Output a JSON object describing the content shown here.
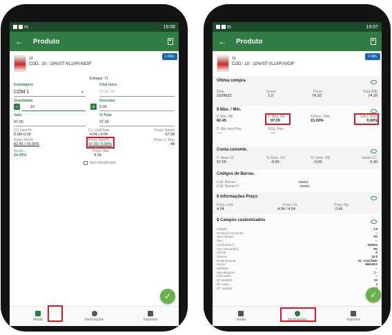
{
  "status": {
    "time_left": "19:06",
    "time_right": "19:07",
    "left_glyph": "m"
  },
  "appbar": {
    "title": "Produto",
    "info_button": "+ Info."
  },
  "product": {
    "code": "10",
    "description": "COD.: 10 - 10%/ST-VL1/IPI-N/DIF"
  },
  "venda": {
    "estoque": "Estoque: 71",
    "embalagem_label": "Embalagem",
    "embalagem_value": "COM 1",
    "filial_label": "Filial retira",
    "filial_value": "FILIAL 99",
    "quantidade_label": "Quantidade",
    "quantidade_value": "10",
    "desconto_label": "Desconto",
    "desconto_value": "0.00",
    "valor_label": "Valor",
    "valor_value": "97.00",
    "vl_total_label": "Vl Total",
    "vl_total_value": "97.00",
    "cc_label": "CC Valor/%",
    "cc_value": "0.00/-0.00",
    "ct_label": "C.t. Unit/Total",
    "ct_value": "4.04 / 4.04",
    "preco_sub_label": "Preço Tabela",
    "preco_sub_value": "97.00",
    "preco_min_label": "Preço Min/%",
    "preco_min_value": "82.45 / 15.00%",
    "preco_max_label": "Preço Máx/%",
    "preco_max_value": "97.00 / 0.00%",
    "preco_s_label": "Preço S. Mun",
    "preco_s_value": "48",
    "lucro_label": "%Lucr.:",
    "lucro_value": "24.95%",
    "preco_unit_label": "Preço Unit.",
    "preco_unit_value": "4.04",
    "bonificado_label": "Item Bonificado"
  },
  "info": {
    "ultima_compra": {
      "title": "Última compra",
      "data_label": "Data",
      "data": "15/08/22",
      "quant_label": "Quant.",
      "quant": "1.0",
      "preco_label": "Preço",
      "preco": "74.20",
      "total_label": "Total (R$)",
      "total": "74.20"
    },
    "maxmin": {
      "title": "$ Máx. / Mín.",
      "pmin_label": "P. Mín. R$",
      "pmin": "82.45",
      "pmax_label": "P. Máx. R$",
      "pmax": "97.00",
      "desc_label": "%Desc. Máx",
      "desc": "15.00%",
      "acr_label": "%Acr. Máx.",
      "acr": "0,00%",
      "pmin_flex_label": "P. Mín sem Flex.",
      "pmin_flex": "----",
      "flex_label": "%Sd. Flex.",
      "flex": "----"
    },
    "conta": {
      "title": "Conta corrente.",
      "base_label": "P. Base CC.",
      "base": "97.00",
      "pdesc_label": "% Desc. CC",
      "pdesc": "-0.00",
      "vdesc_label": "Vl. Desc. R$",
      "vdesc": "-0.00",
      "saldo_label": "Saldo CC.",
      "saldo": "0.00"
    },
    "barras": {
      "title": "Códigos de Barras.",
      "cod_label": "Cód. Barras:",
      "cod": "100001",
      "codb_label": "Cód. Barras D:",
      "codb": "100001"
    },
    "preco": {
      "title": "$ Informações Preço",
      "unit_label": "Preço Unit.",
      "unit": "4.04",
      "cx_label": "Preço Cx.",
      "cx": "4.04 / 4.04",
      "kg_label": "Preço Kg",
      "kg": "0.40"
    },
    "campos": {
      "title": "$ Campos customizados",
      "labels": [
        "Múltiplo:",
        "Restrição transporte:",
        "Tipo estoque:",
        "País:",
        "Cód barras 2:",
        "Tipo mercadoria:",
        "Classe:",
        "Volume:",
        "Departamento:",
        "Seção:",
        "Validade:",
        "Subcategoria:",
        "Filial retira:",
        "Qt caduatra:",
        "QT caixa :",
        "QT unidade :"
      ],
      "values": [
        "1.0",
        "--",
        "PA",
        "--",
        "100001",
        "PA",
        "A",
        "10.0",
        "10 - COLÔNIA",
        "BELEZA",
        "--",
        "1 -",
        "--",
        "01",
        "1",
        "24"
      ]
    }
  },
  "nav": {
    "venda": "Venda",
    "informacoes": "Informações",
    "impostos": "Impostos"
  }
}
